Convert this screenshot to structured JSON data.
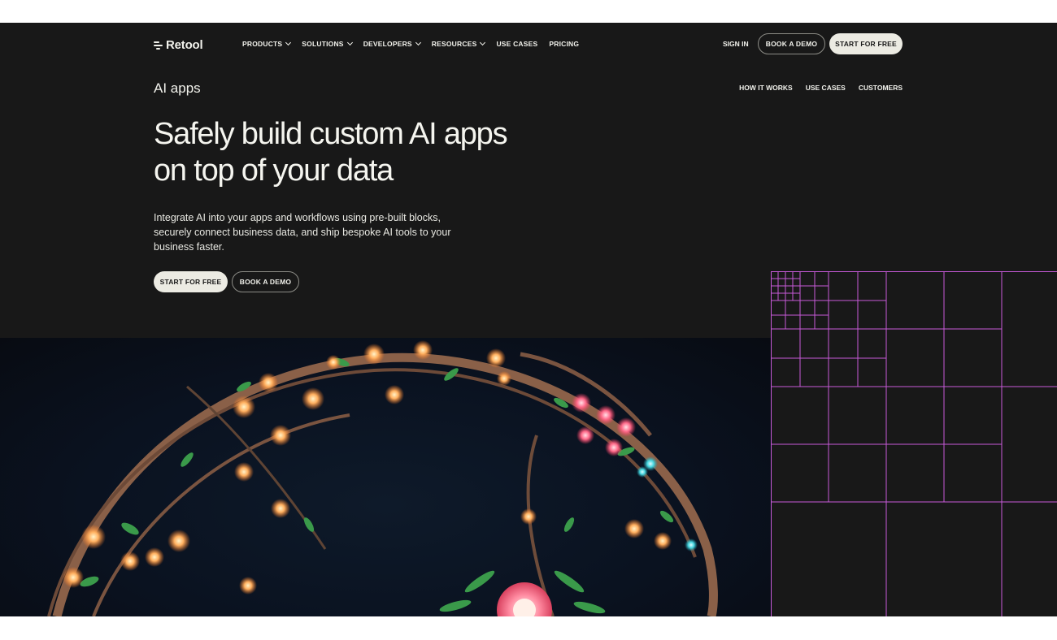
{
  "nav": {
    "logo_text": "Retool",
    "items": [
      {
        "label": "PRODUCTS",
        "has_menu": true
      },
      {
        "label": "SOLUTIONS",
        "has_menu": true
      },
      {
        "label": "DEVELOPERS",
        "has_menu": true
      },
      {
        "label": "RESOURCES",
        "has_menu": true
      },
      {
        "label": "USE CASES",
        "has_menu": false
      },
      {
        "label": "PRICING",
        "has_menu": false
      }
    ],
    "sign_in": "SIGN IN",
    "book_demo": "BOOK A DEMO",
    "start_free": "START FOR FREE"
  },
  "subnav": {
    "title": "AI apps",
    "links": [
      "HOW IT WORKS",
      "USE CASES",
      "CUSTOMERS"
    ]
  },
  "hero": {
    "title_line1": "Safely build custom AI apps",
    "title_line2": "on top of your data",
    "description": "Integrate AI into your apps and workflows using pre-built blocks, securely connect business data, and ship bespoke AI tools to your business faster.",
    "primary_cta": "START FOR FREE",
    "secondary_cta": "BOOK A DEMO"
  },
  "colors": {
    "background": "#181818",
    "text": "#f2f2ec",
    "button_light": "#ecebe3",
    "grid_line": "#c75ad8",
    "glow_orange": "#ffb060",
    "glow_pink": "#ff6a8a",
    "leaf_green": "#3a9a4a"
  },
  "icons": {
    "logo": "retool-logo-icon",
    "chevron": "chevron-down-icon"
  }
}
